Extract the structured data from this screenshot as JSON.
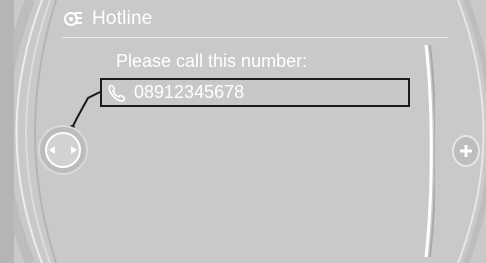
{
  "header": {
    "title": "Hotline",
    "icon": "settings-phone-icon"
  },
  "content": {
    "prompt": "Please call this number:",
    "number_item": {
      "icon": "phone-handset-icon",
      "label": "08912345678"
    }
  },
  "controller": {
    "icon": "left-right-arrows-icon"
  },
  "side_button": {
    "icon": "plus-icon",
    "label": "+"
  },
  "colors": {
    "background": "#c9c9c9",
    "text": "#ffffff",
    "highlight_border": "#1a1a1a"
  }
}
